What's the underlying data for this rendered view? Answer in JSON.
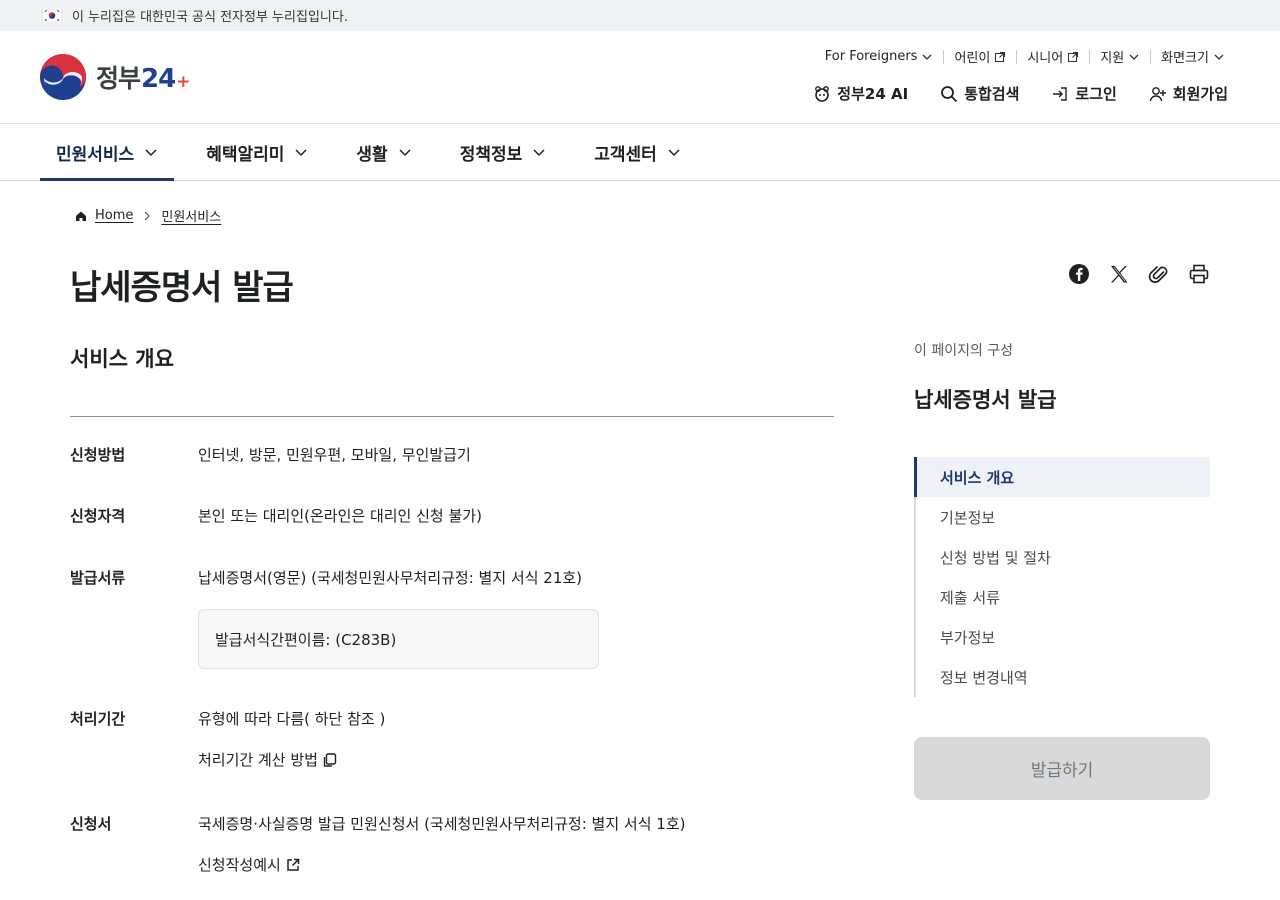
{
  "banner": {
    "text": "이 누리집은 대한민국 공식 전자정부 누리집입니다."
  },
  "logo": {
    "word": "정부",
    "num": "24",
    "plus": "+"
  },
  "util_menu": [
    {
      "label": "For Foreigners",
      "icon": "chevron-down-icon"
    },
    {
      "label": "어린이",
      "icon": "external-link-icon"
    },
    {
      "label": "시니어",
      "icon": "external-link-icon"
    },
    {
      "label": "지원",
      "icon": "chevron-down-icon"
    },
    {
      "label": "화면크기",
      "icon": "chevron-down-icon"
    }
  ],
  "actions": [
    {
      "label": "정부24 AI",
      "icon": "ai-icon"
    },
    {
      "label": "통합검색",
      "icon": "search-icon"
    },
    {
      "label": "로그인",
      "icon": "login-icon"
    },
    {
      "label": "회원가입",
      "icon": "add-user-icon"
    }
  ],
  "gnb": [
    {
      "label": "민원서비스",
      "active": true
    },
    {
      "label": "혜택알리미"
    },
    {
      "label": "생활"
    },
    {
      "label": "정책정보"
    },
    {
      "label": "고객센터"
    }
  ],
  "breadcrumb": {
    "home": "Home",
    "current": "민원서비스"
  },
  "page": {
    "title": "납세증명서 발급"
  },
  "share_icons": [
    "facebook-icon",
    "x-icon",
    "link-icon",
    "print-icon"
  ],
  "overview": {
    "title": "서비스 개요",
    "rows": {
      "method": {
        "label": "신청방법",
        "value": "인터넷, 방문, 민원우편, 모바일, 무인발급기"
      },
      "qualification": {
        "label": "신청자격",
        "value": "본인 또는 대리인(온라인은 대리인 신청 불가)"
      },
      "documents": {
        "label": "발급서류",
        "value": "납세증명서(영문) (국세청민원사무처리규정: 별지 서식 21호)",
        "box": "발급서식간편이름: (C283B)"
      },
      "period": {
        "label": "처리기간",
        "value": "유형에 따라 다름( 하단 참조 )",
        "link": "처리기간 계산 방법"
      },
      "form": {
        "label": "신청서",
        "value": "국세증명·사실증명 발급 민원신청서 (국세청민원사무처리규정: 별지 서식 1호)",
        "link": "신청작성예시"
      }
    }
  },
  "sidebar": {
    "caption": "이 페이지의 구성",
    "title": "납세증명서 발급",
    "toc": [
      "서비스 개요",
      "기본정보",
      "신청 방법 및 절차",
      "제출 서류",
      "부가정보",
      "정보 변경내역"
    ],
    "apply_button": "발급하기"
  },
  "colors": {
    "accent": "#1d3a70",
    "banner_bg": "#eef2f7",
    "button_disabled": "#d9d9d9"
  }
}
